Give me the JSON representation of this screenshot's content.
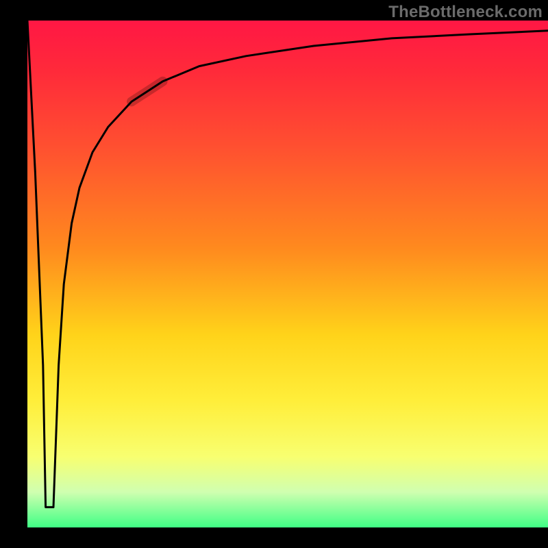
{
  "watermark": "TheBottleneck.com",
  "chart_data": {
    "type": "line",
    "title": "",
    "xlabel": "",
    "ylabel": "",
    "xlim": [
      0,
      100
    ],
    "ylim": [
      0,
      100
    ],
    "background_gradient": {
      "top": "#ff1744",
      "middle": "#ffd31a",
      "bottom": "#3fff85"
    },
    "series": [
      {
        "name": "bottleneck-curve",
        "stroke": "#000000",
        "x": [
          0.0,
          1.5,
          3.0,
          3.5,
          5.0,
          5.5,
          6.0,
          7.0,
          8.5,
          10.0,
          12.5,
          15.5,
          20.0,
          26.0,
          33.0,
          42.0,
          55.0,
          70.0,
          85.0,
          100.0
        ],
        "y": [
          100,
          70,
          32,
          4,
          4,
          18,
          32,
          48,
          60,
          67,
          74,
          79,
          84,
          88,
          91,
          93,
          95,
          96.5,
          97.3,
          98
        ]
      },
      {
        "name": "highlight-segment",
        "stroke": "rgba(0,0,0,0.22)",
        "stroke_width": 10,
        "x": [
          20.0,
          26.0
        ],
        "y": [
          84.0,
          88.0
        ]
      }
    ],
    "annotations": []
  }
}
